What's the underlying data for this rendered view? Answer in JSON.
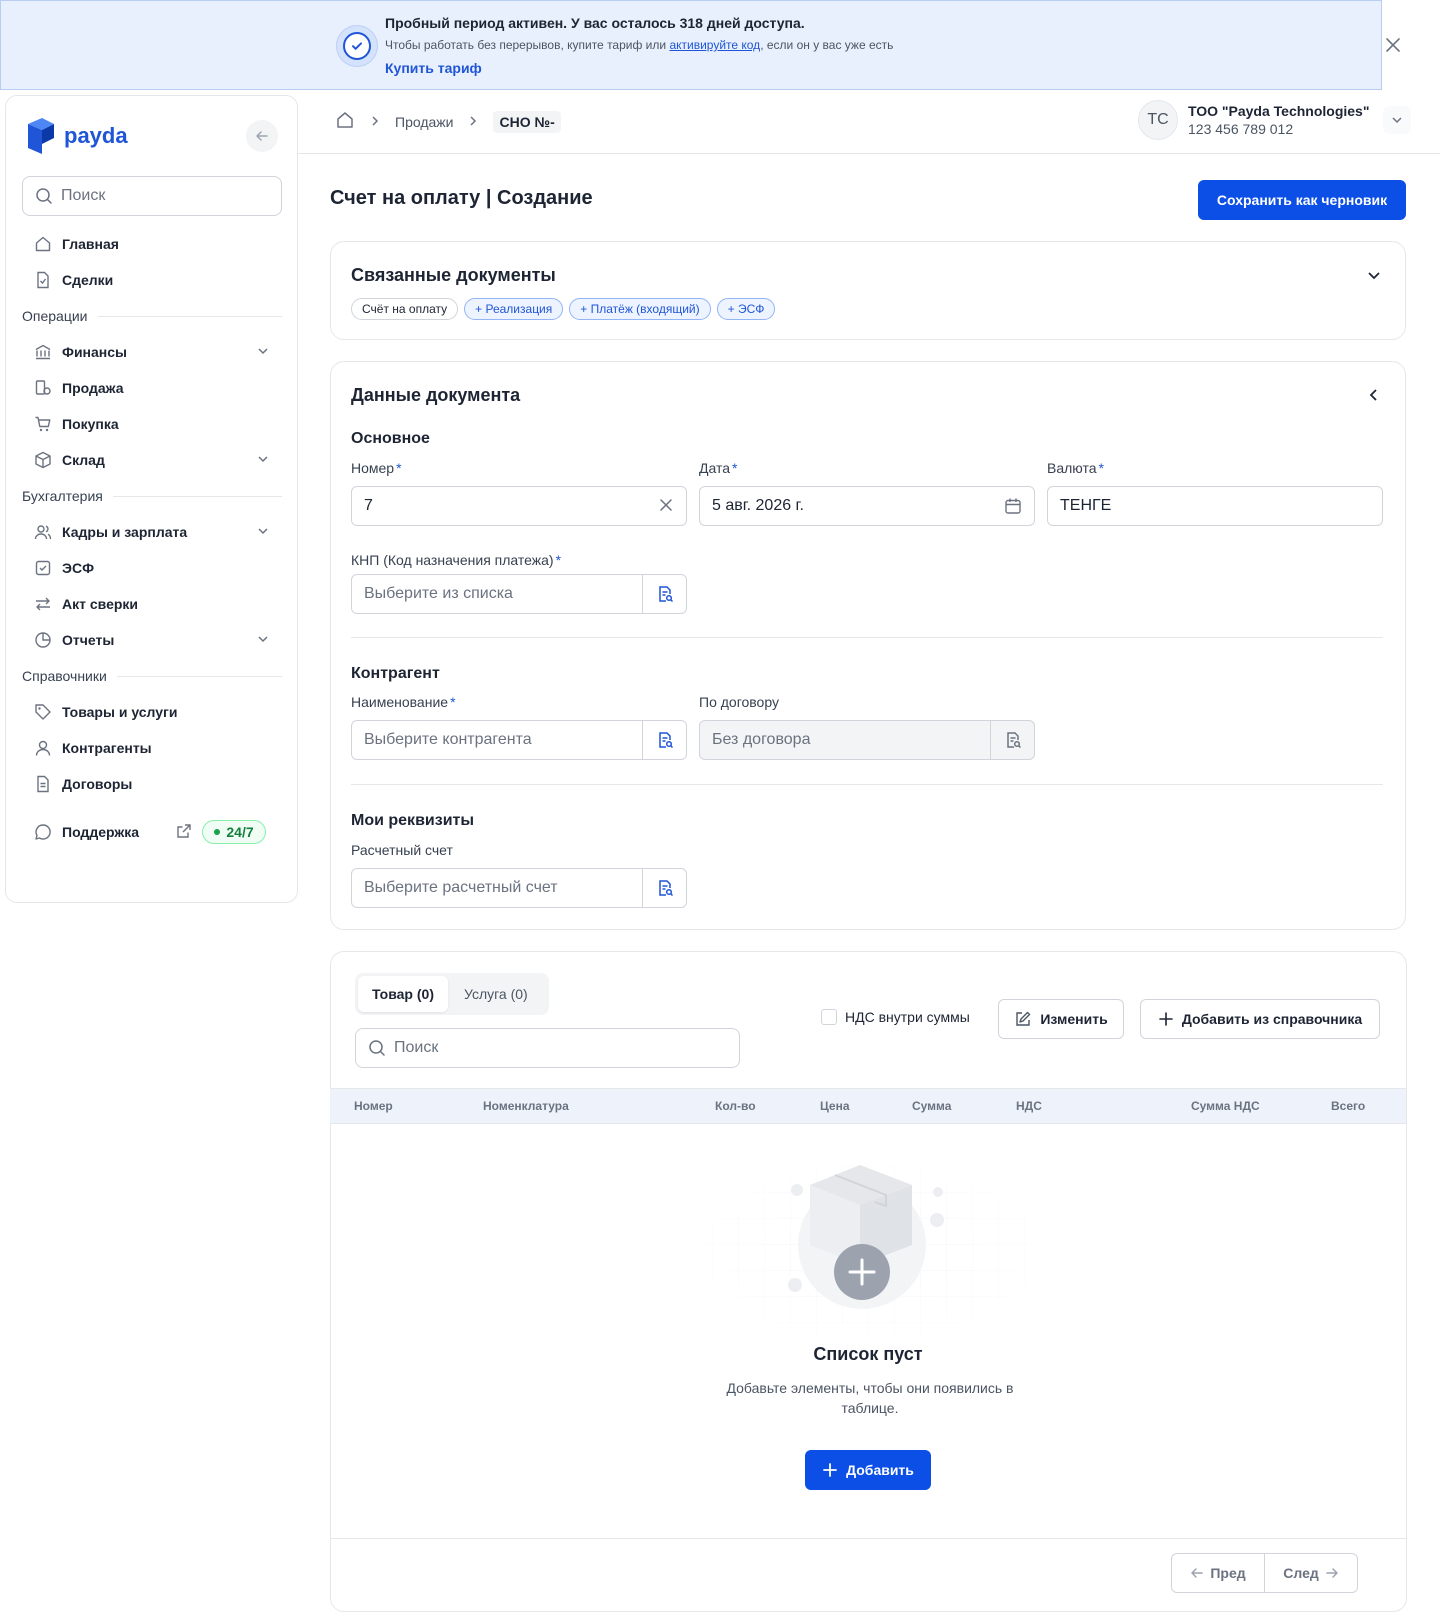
{
  "banner": {
    "title": "Пробный период активен. У вас осталось 318 дней доступа.",
    "text_before": "Чтобы работать без перерывов, купите тариф или ",
    "link": "активируйте код",
    "text_after": ", если он у вас уже есть",
    "action": "Купить тариф"
  },
  "sidebar": {
    "logo": "payda",
    "search_placeholder": "Поиск",
    "items": [
      {
        "label": "Главная"
      },
      {
        "label": "Сделки"
      },
      {
        "group": "Операции"
      },
      {
        "label": "Финансы"
      },
      {
        "label": "Продажа"
      },
      {
        "label": "Покупка"
      },
      {
        "label": "Склад"
      },
      {
        "group": "Бухгалтерия"
      },
      {
        "label": "Кадры и зарплата"
      },
      {
        "label": "ЭСФ"
      },
      {
        "label": "Акт сверки"
      },
      {
        "label": "Отчеты"
      },
      {
        "group": "Справочники"
      },
      {
        "label": "Товары и услуги"
      },
      {
        "label": "Контрагенты"
      },
      {
        "label": "Договоры"
      }
    ],
    "support": "Поддержка",
    "support_badge": "24/7"
  },
  "topbar": {
    "crumbs": [
      "Продажи",
      "СНО №-"
    ],
    "org_initials": "TC",
    "org_name": "ТОО \"Payda Technologies\"",
    "org_id": "123 456 789 012"
  },
  "page": {
    "title": "Счет на оплату | Создание",
    "save_draft": "Сохранить как черновик"
  },
  "related": {
    "title": "Связанные документы",
    "chips": [
      "Счёт на оплату",
      "+ Реализация",
      "+ Платёж (входящий)",
      "+ ЭСФ"
    ]
  },
  "doc": {
    "title": "Данные документа",
    "basic": "Основное",
    "number_label": "Номер",
    "number_value": "7",
    "date_label": "Дата",
    "date_value": "5 авг. 2026 г.",
    "currency_label": "Валюта",
    "currency_value": "ТЕНГЕ",
    "knp_label": "КНП (Код назначения платежа)",
    "knp_placeholder": "Выберите из списка",
    "counterparty": "Контрагент",
    "name_label": "Наименование",
    "name_placeholder": "Выберите контрагента",
    "contract_label": "По договору",
    "contract_placeholder": "Без договора",
    "requisites": "Мои реквизиты",
    "account_label": "Расчетный счет",
    "account_placeholder": "Выберите расчетный счет"
  },
  "goods": {
    "tab_goods": "Товар (0)",
    "tab_services": "Услуга (0)",
    "search_placeholder": "Поиск",
    "vat_inside": "НДС внутри суммы",
    "edit": "Изменить",
    "add_from_ref": "Добавить из справочника",
    "columns": [
      "Номер",
      "Номенклатура",
      "Кол-во",
      "Цена",
      "Сумма",
      "НДС",
      "Сумма НДС",
      "Всего"
    ],
    "empty_title": "Список пуст",
    "empty_text": "Добавьте элементы, чтобы они появились в таблице.",
    "add": "Добавить",
    "prev": "Пред",
    "next": "След"
  },
  "colors": {
    "accent": "#0b4fe6",
    "banner_bg": "#e8f0fd",
    "support_badge": "#15803d"
  }
}
